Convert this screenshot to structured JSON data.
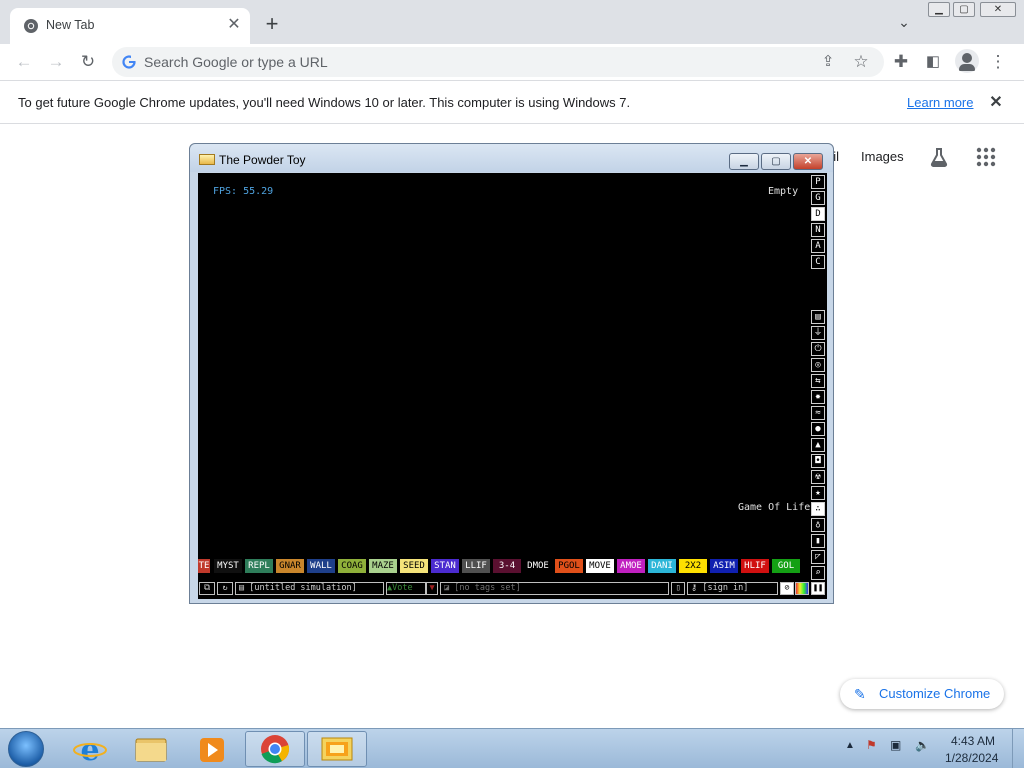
{
  "browser": {
    "tab": {
      "title": "New Tab",
      "close_icon": "close-icon"
    },
    "new_tab_icon": "plus-icon",
    "window_controls": {
      "minimize": "minimize-icon",
      "maximize": "maximize-icon",
      "close": "close-icon"
    },
    "omnibox": {
      "placeholder": "Search Google or type a URL"
    },
    "infobar": {
      "message": "To get future Google Chrome updates, you'll need Windows 10 or later. This computer is using Windows 7.",
      "link": "Learn more"
    },
    "ntp": {
      "gmail": "ail",
      "images": "Images",
      "customize": "Customize Chrome"
    }
  },
  "powder_toy": {
    "title": "The Powder Toy",
    "fps": "FPS: 55.29",
    "hover_status": "Empty",
    "hover_element": "Game Of Life",
    "menu_letters": [
      "P",
      "G",
      "D",
      "N",
      "A",
      "C"
    ],
    "active_letter": "D",
    "category_icons": [
      "wall-icon",
      "electronics-icon",
      "powered-icon",
      "sensor-icon",
      "force-icon",
      "explosive-icon",
      "gas-icon",
      "liquid-icon",
      "powder-icon",
      "solid-icon",
      "radioactive-icon",
      "special-icon",
      "life-icon",
      "tools-icon",
      "favorites-icon",
      "decoration-icon",
      "search-icon"
    ],
    "elements": [
      {
        "label": "TE",
        "bg": "#c0392b",
        "fg": "#ffffff"
      },
      {
        "label": "MYST",
        "bg": "#101010",
        "fg": "#ffffff"
      },
      {
        "label": "REPL",
        "bg": "#2e7d5a",
        "fg": "#ffffff"
      },
      {
        "label": "GNAR",
        "bg": "#c9862c",
        "fg": "#000000"
      },
      {
        "label": "WALL",
        "bg": "#1e3f8a",
        "fg": "#ffffff"
      },
      {
        "label": "COAG",
        "bg": "#8fb03a",
        "fg": "#000000"
      },
      {
        "label": "MAZE",
        "bg": "#a9d18e",
        "fg": "#000000"
      },
      {
        "label": "SEED",
        "bg": "#f4e37a",
        "fg": "#000000"
      },
      {
        "label": "STAN",
        "bg": "#4b2bd0",
        "fg": "#ffffff"
      },
      {
        "label": "LLIF",
        "bg": "#505050",
        "fg": "#ffffff"
      },
      {
        "label": "3-4",
        "bg": "#5a1030",
        "fg": "#ffffff"
      },
      {
        "label": "DMOE",
        "bg": "#000000",
        "fg": "#ffffff"
      },
      {
        "label": "PGOL",
        "bg": "#e0501a",
        "fg": "#000000"
      },
      {
        "label": "MOVE",
        "bg": "#ffffff",
        "fg": "#000000"
      },
      {
        "label": "AMOE",
        "bg": "#c020c0",
        "fg": "#ffffff"
      },
      {
        "label": "DANI",
        "bg": "#2cb6d8",
        "fg": "#ffffff"
      },
      {
        "label": "2X2",
        "bg": "#ffe000",
        "fg": "#000000"
      },
      {
        "label": "ASIM",
        "bg": "#1020b0",
        "fg": "#ffffff"
      },
      {
        "label": "HLIF",
        "bg": "#d01010",
        "fg": "#ffffff"
      },
      {
        "label": "GOL",
        "bg": "#14a014",
        "fg": "#ffffff"
      }
    ],
    "bottom_bar": {
      "save_name": "[untitled simulation]",
      "vote": "Vote",
      "tags": "[no tags set]",
      "sign_in": "[sign in]"
    }
  },
  "taskbar": {
    "apps": [
      "ie-icon",
      "explorer-icon",
      "media-player-icon",
      "chrome-icon",
      "powder-toy-icon"
    ],
    "time": "4:43 AM",
    "date": "1/28/2024"
  }
}
